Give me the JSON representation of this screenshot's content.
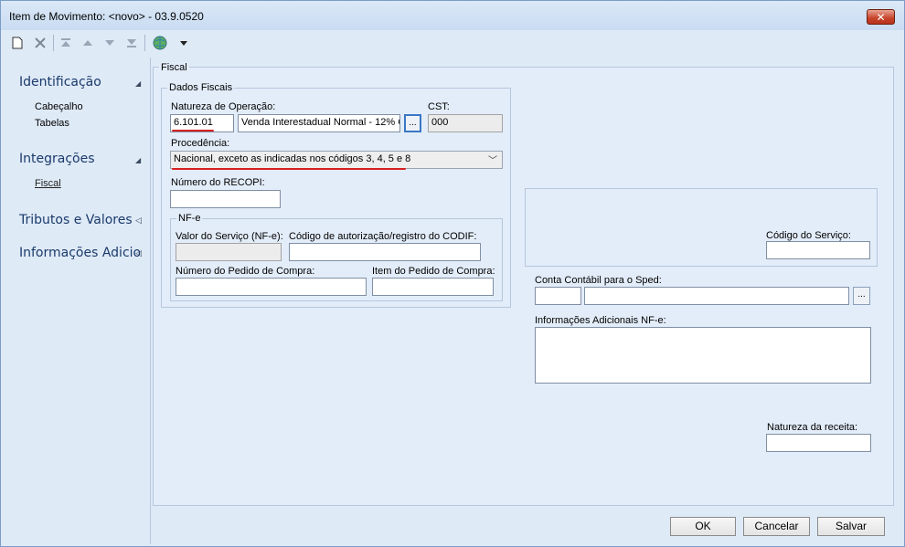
{
  "window": {
    "title": "Item de Movimento: <novo> - 03.9.0520",
    "close_label": "✕"
  },
  "toolbar": {
    "icons": [
      "new-document-icon",
      "delete-icon",
      "first-icon",
      "previous-icon",
      "next-icon",
      "last-icon",
      "globe-icon",
      "dropdown-arrow-icon"
    ]
  },
  "sidebar": {
    "groups": [
      {
        "label": "Identificação",
        "items": [
          "Cabeçalho",
          "Tabelas"
        ]
      },
      {
        "label": "Integrações",
        "items": [
          "Fiscal"
        ]
      },
      {
        "label": "Tributos e Valores",
        "items": []
      },
      {
        "label": "Informações Adicio",
        "items": []
      }
    ]
  },
  "content": {
    "section_title": "Fiscal",
    "dados_fiscais": {
      "legend": "Dados Fiscais",
      "natureza_label": "Natureza de Operação:",
      "natureza_code": "6.101.01",
      "natureza_desc": "Venda Interestadual Normal - 12% C",
      "natureza_lookup": "...",
      "cst_label": "CST:",
      "cst_value": "000",
      "procedencia_label": "Procedência:",
      "procedencia_value": "Nacional, exceto as indicadas nos códigos 3, 4, 5 e 8",
      "recopi_label": "Número do RECOPI:",
      "recopi_value": ""
    },
    "nfe": {
      "legend": "NF-e",
      "valor_servico_label": "Valor do Serviço (NF-e):",
      "codif_label": "Código de autorização/registro do CODIF:",
      "pedido_label": "Número do Pedido de Compra:",
      "item_pedido_label": "Item do Pedido de Compra:"
    },
    "codigo_servico_label": "Código do Serviço:",
    "conta_contabil_label": "Conta Contábil para o Sped:",
    "conta_lookup": "...",
    "info_adicionais_label": "Informações Adicionais NF-e:",
    "natureza_receita_label": "Natureza da receita:"
  },
  "buttons": {
    "ok": "OK",
    "cancel": "Cancelar",
    "save": "Salvar"
  }
}
